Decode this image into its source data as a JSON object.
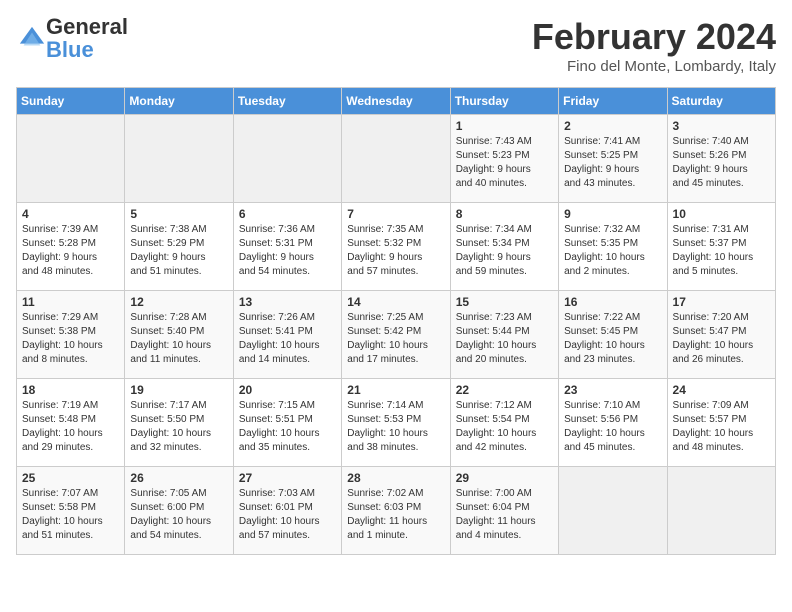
{
  "header": {
    "logo_general": "General",
    "logo_blue": "Blue",
    "title": "February 2024",
    "subtitle": "Fino del Monte, Lombardy, Italy"
  },
  "days_of_week": [
    "Sunday",
    "Monday",
    "Tuesday",
    "Wednesday",
    "Thursday",
    "Friday",
    "Saturday"
  ],
  "weeks": [
    {
      "days": [
        {
          "num": "",
          "info": ""
        },
        {
          "num": "",
          "info": ""
        },
        {
          "num": "",
          "info": ""
        },
        {
          "num": "",
          "info": ""
        },
        {
          "num": "1",
          "info": "Sunrise: 7:43 AM\nSunset: 5:23 PM\nDaylight: 9 hours\nand 40 minutes."
        },
        {
          "num": "2",
          "info": "Sunrise: 7:41 AM\nSunset: 5:25 PM\nDaylight: 9 hours\nand 43 minutes."
        },
        {
          "num": "3",
          "info": "Sunrise: 7:40 AM\nSunset: 5:26 PM\nDaylight: 9 hours\nand 45 minutes."
        }
      ]
    },
    {
      "days": [
        {
          "num": "4",
          "info": "Sunrise: 7:39 AM\nSunset: 5:28 PM\nDaylight: 9 hours\nand 48 minutes."
        },
        {
          "num": "5",
          "info": "Sunrise: 7:38 AM\nSunset: 5:29 PM\nDaylight: 9 hours\nand 51 minutes."
        },
        {
          "num": "6",
          "info": "Sunrise: 7:36 AM\nSunset: 5:31 PM\nDaylight: 9 hours\nand 54 minutes."
        },
        {
          "num": "7",
          "info": "Sunrise: 7:35 AM\nSunset: 5:32 PM\nDaylight: 9 hours\nand 57 minutes."
        },
        {
          "num": "8",
          "info": "Sunrise: 7:34 AM\nSunset: 5:34 PM\nDaylight: 9 hours\nand 59 minutes."
        },
        {
          "num": "9",
          "info": "Sunrise: 7:32 AM\nSunset: 5:35 PM\nDaylight: 10 hours\nand 2 minutes."
        },
        {
          "num": "10",
          "info": "Sunrise: 7:31 AM\nSunset: 5:37 PM\nDaylight: 10 hours\nand 5 minutes."
        }
      ]
    },
    {
      "days": [
        {
          "num": "11",
          "info": "Sunrise: 7:29 AM\nSunset: 5:38 PM\nDaylight: 10 hours\nand 8 minutes."
        },
        {
          "num": "12",
          "info": "Sunrise: 7:28 AM\nSunset: 5:40 PM\nDaylight: 10 hours\nand 11 minutes."
        },
        {
          "num": "13",
          "info": "Sunrise: 7:26 AM\nSunset: 5:41 PM\nDaylight: 10 hours\nand 14 minutes."
        },
        {
          "num": "14",
          "info": "Sunrise: 7:25 AM\nSunset: 5:42 PM\nDaylight: 10 hours\nand 17 minutes."
        },
        {
          "num": "15",
          "info": "Sunrise: 7:23 AM\nSunset: 5:44 PM\nDaylight: 10 hours\nand 20 minutes."
        },
        {
          "num": "16",
          "info": "Sunrise: 7:22 AM\nSunset: 5:45 PM\nDaylight: 10 hours\nand 23 minutes."
        },
        {
          "num": "17",
          "info": "Sunrise: 7:20 AM\nSunset: 5:47 PM\nDaylight: 10 hours\nand 26 minutes."
        }
      ]
    },
    {
      "days": [
        {
          "num": "18",
          "info": "Sunrise: 7:19 AM\nSunset: 5:48 PM\nDaylight: 10 hours\nand 29 minutes."
        },
        {
          "num": "19",
          "info": "Sunrise: 7:17 AM\nSunset: 5:50 PM\nDaylight: 10 hours\nand 32 minutes."
        },
        {
          "num": "20",
          "info": "Sunrise: 7:15 AM\nSunset: 5:51 PM\nDaylight: 10 hours\nand 35 minutes."
        },
        {
          "num": "21",
          "info": "Sunrise: 7:14 AM\nSunset: 5:53 PM\nDaylight: 10 hours\nand 38 minutes."
        },
        {
          "num": "22",
          "info": "Sunrise: 7:12 AM\nSunset: 5:54 PM\nDaylight: 10 hours\nand 42 minutes."
        },
        {
          "num": "23",
          "info": "Sunrise: 7:10 AM\nSunset: 5:56 PM\nDaylight: 10 hours\nand 45 minutes."
        },
        {
          "num": "24",
          "info": "Sunrise: 7:09 AM\nSunset: 5:57 PM\nDaylight: 10 hours\nand 48 minutes."
        }
      ]
    },
    {
      "days": [
        {
          "num": "25",
          "info": "Sunrise: 7:07 AM\nSunset: 5:58 PM\nDaylight: 10 hours\nand 51 minutes."
        },
        {
          "num": "26",
          "info": "Sunrise: 7:05 AM\nSunset: 6:00 PM\nDaylight: 10 hours\nand 54 minutes."
        },
        {
          "num": "27",
          "info": "Sunrise: 7:03 AM\nSunset: 6:01 PM\nDaylight: 10 hours\nand 57 minutes."
        },
        {
          "num": "28",
          "info": "Sunrise: 7:02 AM\nSunset: 6:03 PM\nDaylight: 11 hours\nand 1 minute."
        },
        {
          "num": "29",
          "info": "Sunrise: 7:00 AM\nSunset: 6:04 PM\nDaylight: 11 hours\nand 4 minutes."
        },
        {
          "num": "",
          "info": ""
        },
        {
          "num": "",
          "info": ""
        }
      ]
    }
  ]
}
